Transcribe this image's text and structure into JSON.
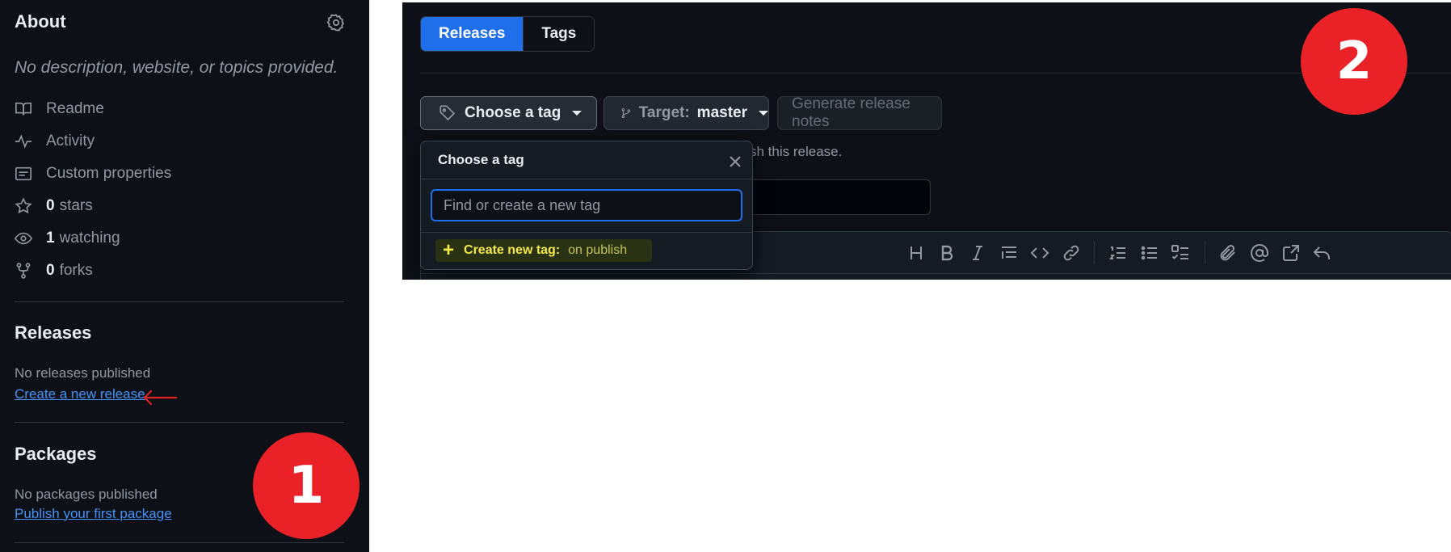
{
  "panel1": {
    "about": {
      "title": "About",
      "description": "No description, website, or topics provided.",
      "items": [
        {
          "icon": "book-icon",
          "count": "",
          "label": "Readme"
        },
        {
          "icon": "pulse-icon",
          "count": "",
          "label": "Activity"
        },
        {
          "icon": "note-icon",
          "count": "",
          "label": "Custom properties"
        },
        {
          "icon": "star-icon",
          "count": "0",
          "label": "stars"
        },
        {
          "icon": "eye-icon",
          "count": "1",
          "label": "watching"
        },
        {
          "icon": "fork-icon",
          "count": "0",
          "label": "forks"
        }
      ]
    },
    "releases": {
      "title": "Releases",
      "status": "No releases published",
      "link": "Create a new release"
    },
    "packages": {
      "title": "Packages",
      "status": "No packages published",
      "link": "Publish your first package"
    },
    "badge": "1"
  },
  "panel2": {
    "tabs": [
      {
        "label": "Releases",
        "active": true
      },
      {
        "label": "Tags",
        "active": false
      }
    ],
    "choose_tag_button": "Choose a tag",
    "target_button": {
      "label": "Target:",
      "value": "master"
    },
    "generate_notes_button": "Generate release notes",
    "hint_text": "blish this release.",
    "dropdown": {
      "title": "Choose a tag",
      "input_placeholder": "Find or create a new tag",
      "create_label": "Create new tag:",
      "create_value": "on publish"
    },
    "badge": "2"
  },
  "colors": {
    "background": "#0d1117",
    "accent": "#1f6feb",
    "link": "#4493f8",
    "badge": "#ea2227",
    "arrow": "#e02424",
    "highlight": "#f5e84a"
  }
}
